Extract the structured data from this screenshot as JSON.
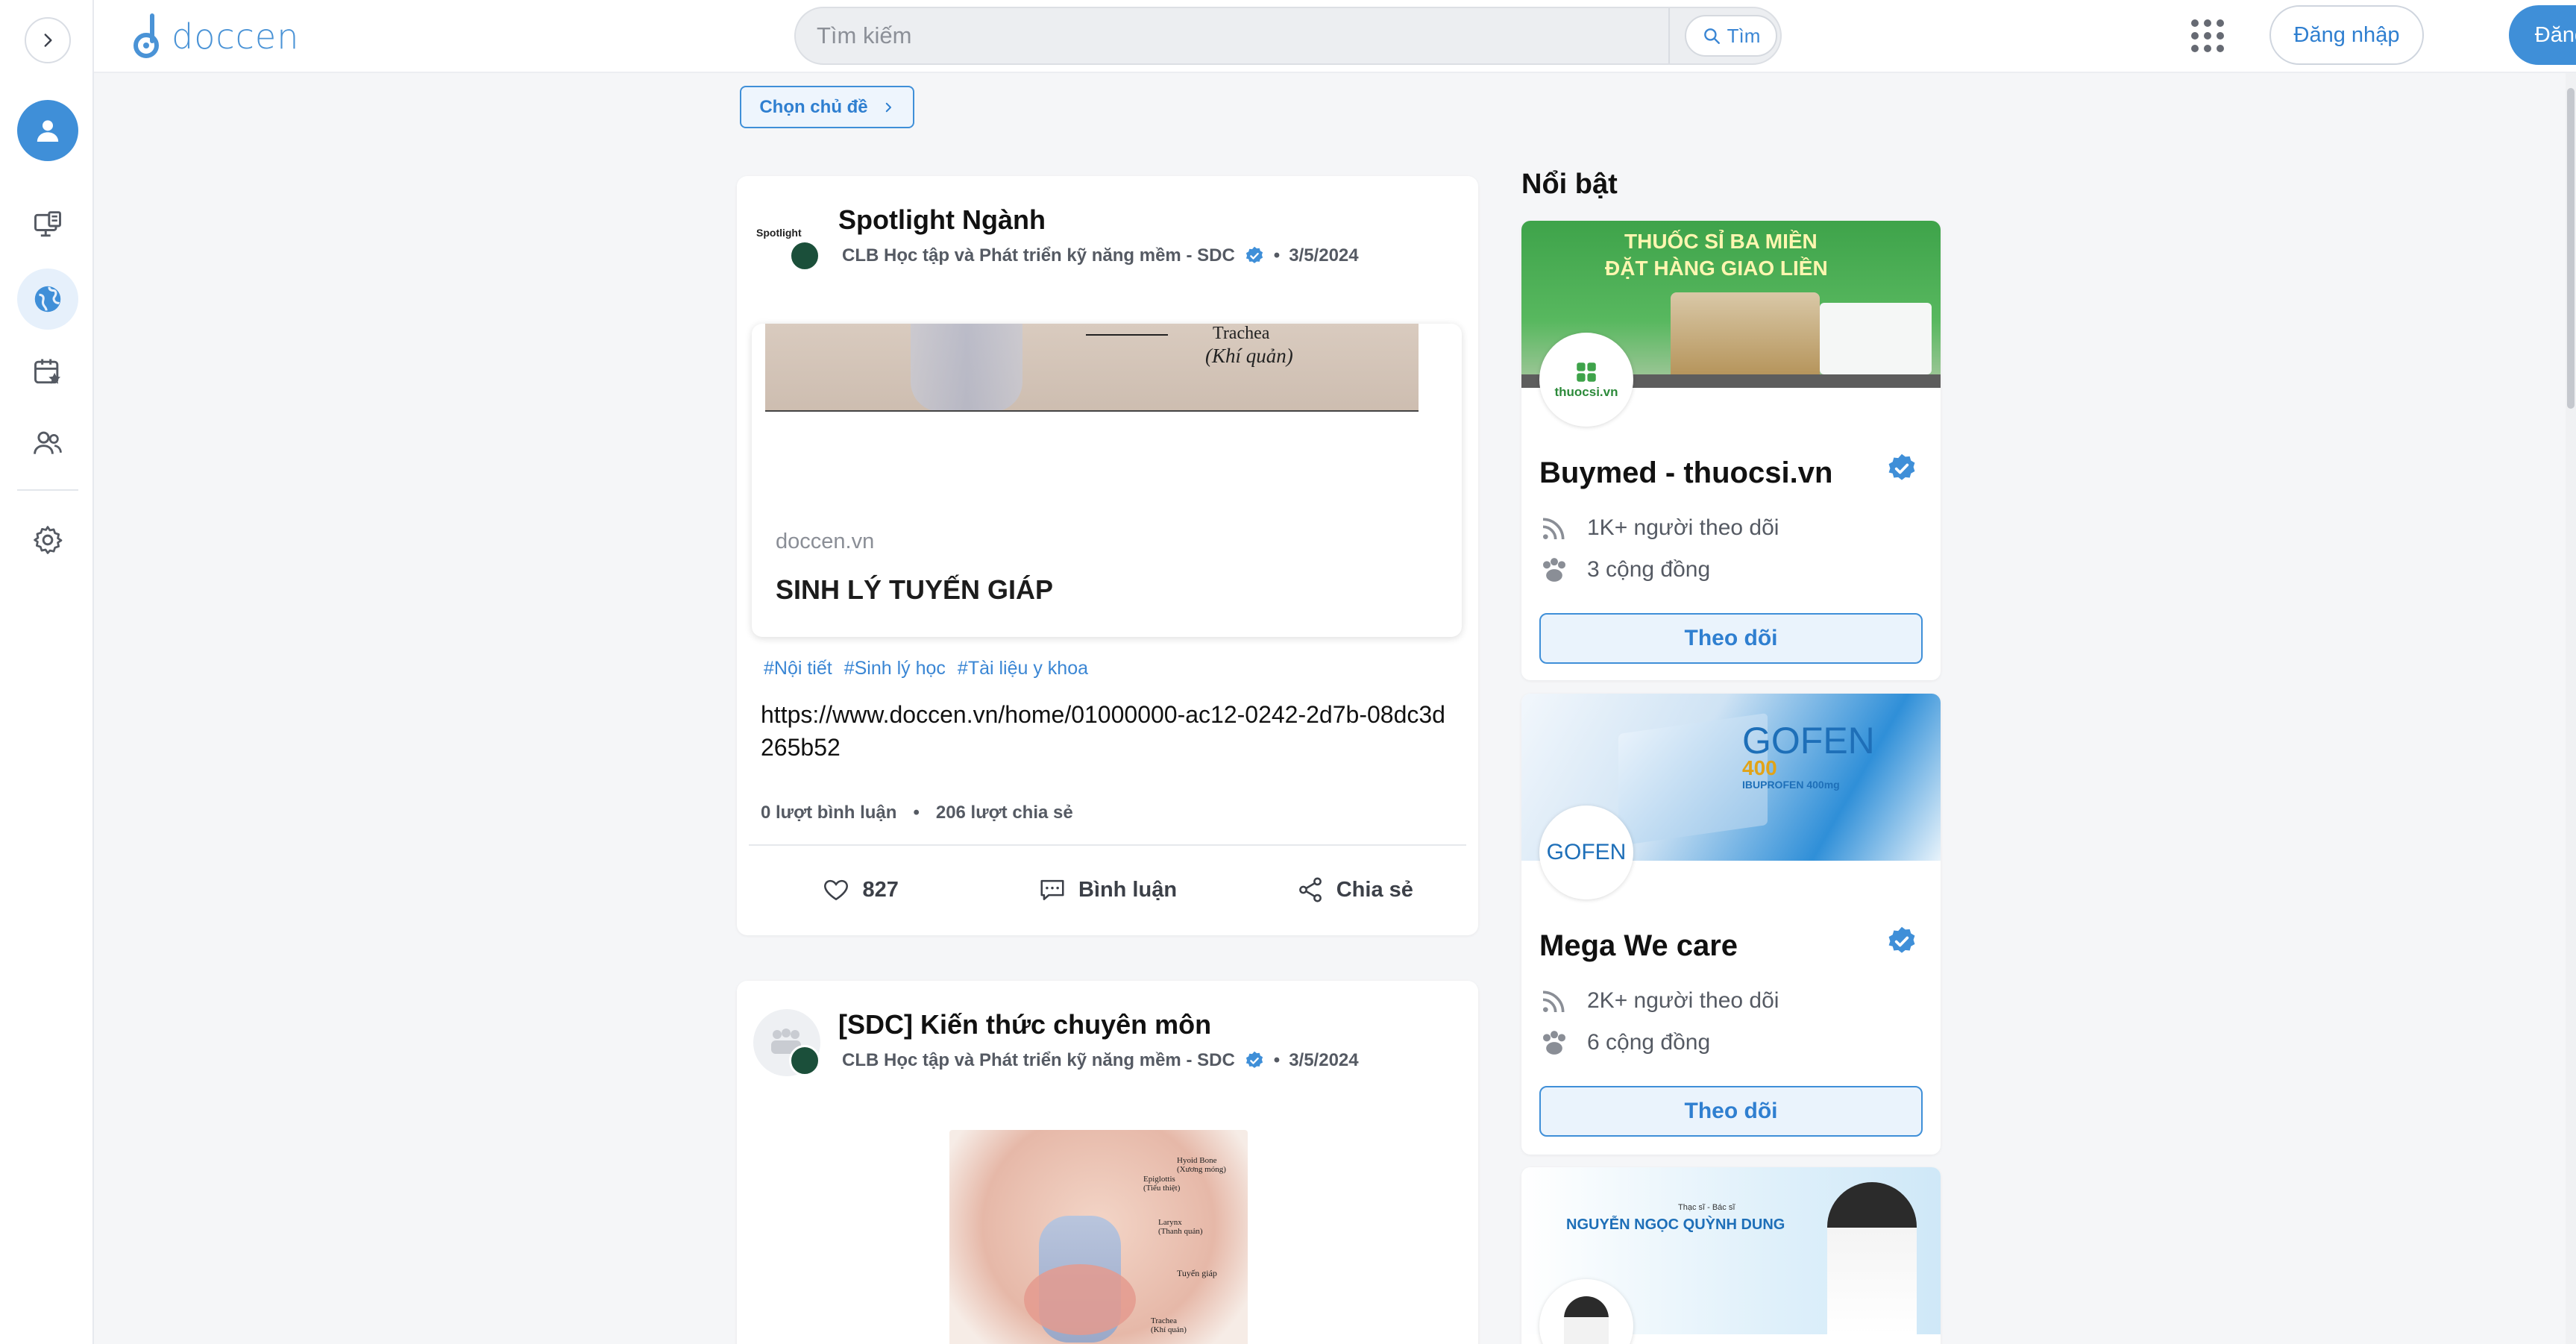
{
  "app": {
    "logo_text": "doccen",
    "brand_color": "#3f8fd8"
  },
  "header": {
    "search_placeholder": "Tìm kiếm",
    "search_button": "Tìm",
    "login_label": "Đăng nhập",
    "register_label": "Đăng ký"
  },
  "sidebar": {
    "items": [
      {
        "name": "toggle",
        "icon": "chevron-right-icon"
      },
      {
        "name": "profile",
        "icon": "user-icon"
      },
      {
        "name": "articles",
        "icon": "monitor-doc-icon"
      },
      {
        "name": "explore",
        "icon": "globe-icon",
        "active": true
      },
      {
        "name": "events",
        "icon": "calendar-star-icon"
      },
      {
        "name": "community",
        "icon": "users-icon"
      },
      {
        "name": "settings",
        "icon": "gear-icon"
      }
    ]
  },
  "topic_chooser": {
    "label": "Chọn chủ đề"
  },
  "posts": [
    {
      "title": "Spotlight Ngành",
      "author": "CLB Học tập và Phát triển kỹ năng mềm - SDC",
      "date": "3/5/2024",
      "avatar_text": "Spotlight",
      "image_caption_1": "Trachea",
      "image_caption_2": "(Khí quản)",
      "preview_domain": "doccen.vn",
      "preview_title": "SINH LÝ TUYẾN GIÁP",
      "tags": [
        "#Nội tiết",
        "#Sinh lý học",
        "#Tài liệu y khoa"
      ],
      "url": "https://www.doccen.vn/home/01000000-ac12-0242-2d7b-08dc3d265b52",
      "comments": "0 lượt bình luận",
      "shares": "206 lượt chia sẻ",
      "likes": "827",
      "comment_action": "Bình luận",
      "share_action": "Chia sẻ"
    },
    {
      "title": "[SDC] Kiến thức chuyên môn",
      "author": "CLB Học tập và Phát triển kỹ năng mềm - SDC",
      "date": "3/5/2024",
      "image_labels": [
        "Hyoid Bone",
        "(Xương móng)",
        "Epiglottis",
        "(Tiểu thiệt)",
        "Larynx",
        "(Thanh quản)",
        "Tuyến giáp",
        "Trachea",
        "(Khí quản)"
      ]
    }
  ],
  "featured": {
    "title": "Nổi bật",
    "brands": [
      {
        "name": "Buymed - thuocsi.vn",
        "banner_line1": "THUỐC SỈ BA MIỀN",
        "banner_line2": "ĐẶT HÀNG GIAO LIỀN",
        "logo_text": "thuocsi.vn",
        "followers": "1K+ người theo dõi",
        "communities": "3 cộng đồng",
        "follow_label": "Theo dõi"
      },
      {
        "name": "Mega We care",
        "banner_line1": "GOFEN",
        "banner_line2": "400",
        "banner_line3": "IBUPROFEN 400mg",
        "logo_text": "GOFEN",
        "followers": "2K+ người theo dõi",
        "communities": "6 cộng đồng",
        "follow_label": "Theo dõi"
      },
      {
        "banner_line1": "Thạc sĩ - Bác sĩ",
        "banner_line2": "NGUYỄN NGỌC QUỲNH DUNG"
      }
    ]
  }
}
